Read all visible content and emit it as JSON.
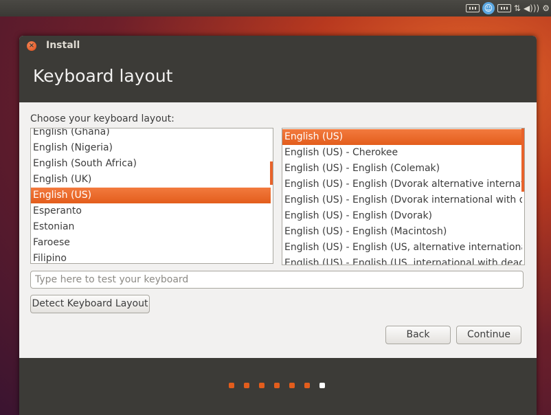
{
  "tray": {
    "icons": [
      "keyboard-icon",
      "accessibility-icon",
      "keyboard-icon",
      "network-icon",
      "volume-icon",
      "gear-icon"
    ]
  },
  "window": {
    "title": "Install",
    "page_title": "Keyboard layout"
  },
  "layout_prompt": "Choose your keyboard layout:",
  "layouts": {
    "items": [
      "English (Ghana)",
      "English (Nigeria)",
      "English (South Africa)",
      "English (UK)",
      "English (US)",
      "Esperanto",
      "Estonian",
      "Faroese",
      "Filipino"
    ],
    "selected": "English (US)"
  },
  "variants": {
    "items": [
      "English (US)",
      "English (US) - Cherokee",
      "English (US) - English (Colemak)",
      "English (US) - English (Dvorak alternative international no dead keys)",
      "English (US) - English (Dvorak international with dead keys)",
      "English (US) - English (Dvorak)",
      "English (US) - English (Macintosh)",
      "English (US) - English (US, alternative international)",
      "English (US) - English (US, international with dead keys)"
    ],
    "selected": "English (US)"
  },
  "test_input": {
    "placeholder": "Type here to test your keyboard",
    "value": ""
  },
  "buttons": {
    "detect": "Detect Keyboard Layout",
    "back": "Back",
    "continue": "Continue"
  },
  "progress": {
    "steps": 7,
    "current": 7,
    "done_color": "#e35d1c",
    "current_color": "#ffffff"
  }
}
